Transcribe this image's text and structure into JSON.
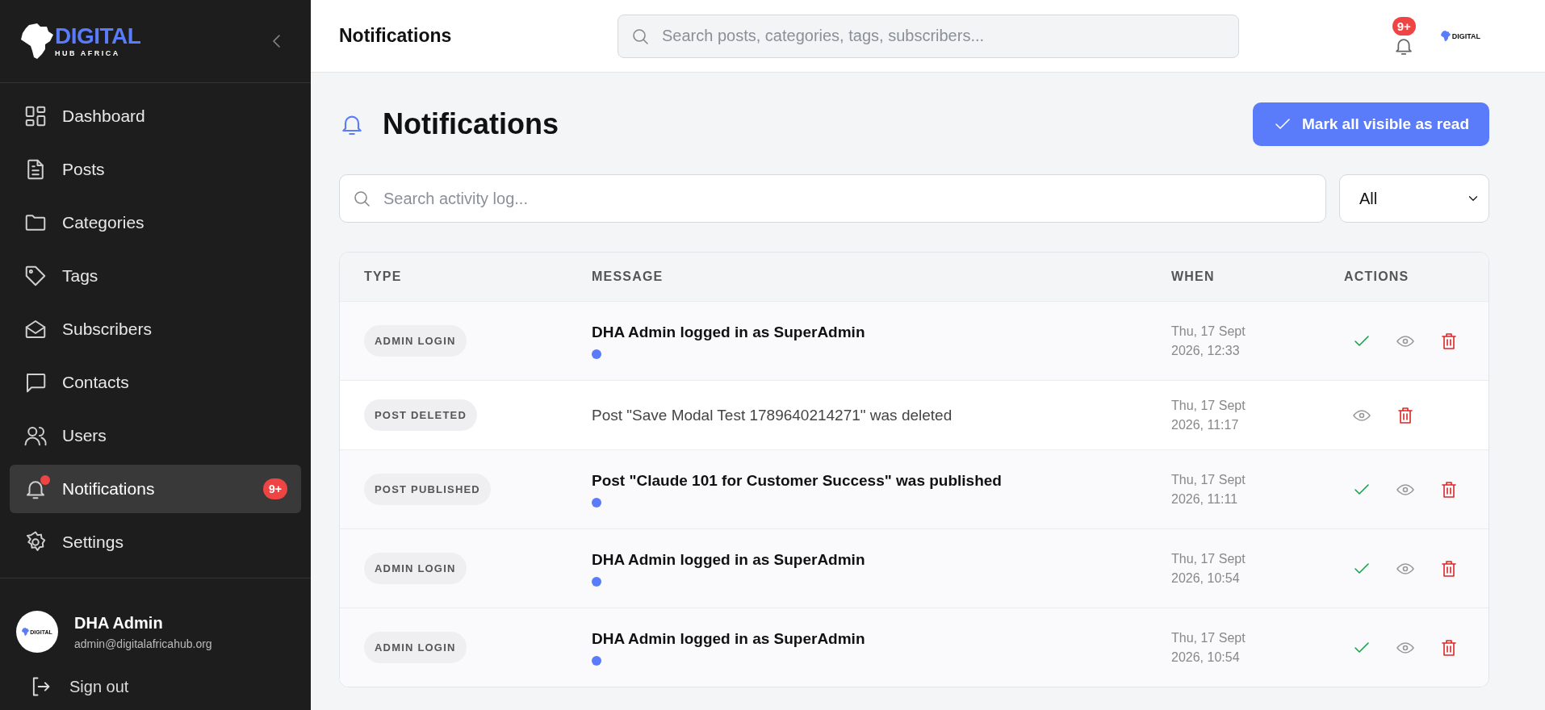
{
  "sidebar": {
    "logo": {
      "title": "DIGITAL",
      "subtitle": "HUB AFRICA"
    },
    "items": [
      {
        "label": "Dashboard",
        "selected": false
      },
      {
        "label": "Posts",
        "selected": false
      },
      {
        "label": "Categories",
        "selected": false
      },
      {
        "label": "Tags",
        "selected": false
      },
      {
        "label": "Subscribers",
        "selected": false
      },
      {
        "label": "Contacts",
        "selected": false
      },
      {
        "label": "Users",
        "selected": false
      },
      {
        "label": "Notifications",
        "selected": true,
        "badge": "9+",
        "alert": true
      },
      {
        "label": "Settings",
        "selected": false
      }
    ],
    "user": {
      "avatar_text": "DIGITAL",
      "name": "DHA Admin",
      "email": "admin@digitalafricahub.org"
    },
    "sign_out": "Sign out"
  },
  "header": {
    "title": "Notifications",
    "search": {
      "placeholder": "Search posts, categories, tags, subscribers..."
    },
    "notification_badge": "9+",
    "logo_text": "DIGITAL"
  },
  "page": {
    "title": "Notifications",
    "mark_all_button": "Mark all visible as read",
    "search": {
      "placeholder": "Search activity log..."
    },
    "filter": {
      "value": "All"
    }
  },
  "table": {
    "columns": [
      "TYPE",
      "MESSAGE",
      "WHEN",
      "ACTIONS"
    ],
    "rows": [
      {
        "type": "ADMIN LOGIN",
        "message": "DHA Admin logged in as SuperAdmin",
        "unread": true,
        "when": [
          "Thu, 17 Sept",
          "2026, 12:33"
        ]
      },
      {
        "type": "POST DELETED",
        "message": "Post \"Save Modal Test 1789640214271\" was deleted",
        "unread": false,
        "when": [
          "Thu, 17 Sept",
          "2026, 11:17"
        ]
      },
      {
        "type": "POST PUBLISHED",
        "message": "Post \"Claude 101 for Customer Success\" was published",
        "unread": true,
        "when": [
          "Thu, 17 Sept",
          "2026, 11:11"
        ]
      },
      {
        "type": "ADMIN LOGIN",
        "message": "DHA Admin logged in as SuperAdmin",
        "unread": true,
        "when": [
          "Thu, 17 Sept",
          "2026, 10:54"
        ]
      },
      {
        "type": "ADMIN LOGIN",
        "message": "DHA Admin logged in as SuperAdmin",
        "unread": true,
        "when": [
          "Thu, 17 Sept",
          "2026, 10:54"
        ]
      }
    ]
  }
}
